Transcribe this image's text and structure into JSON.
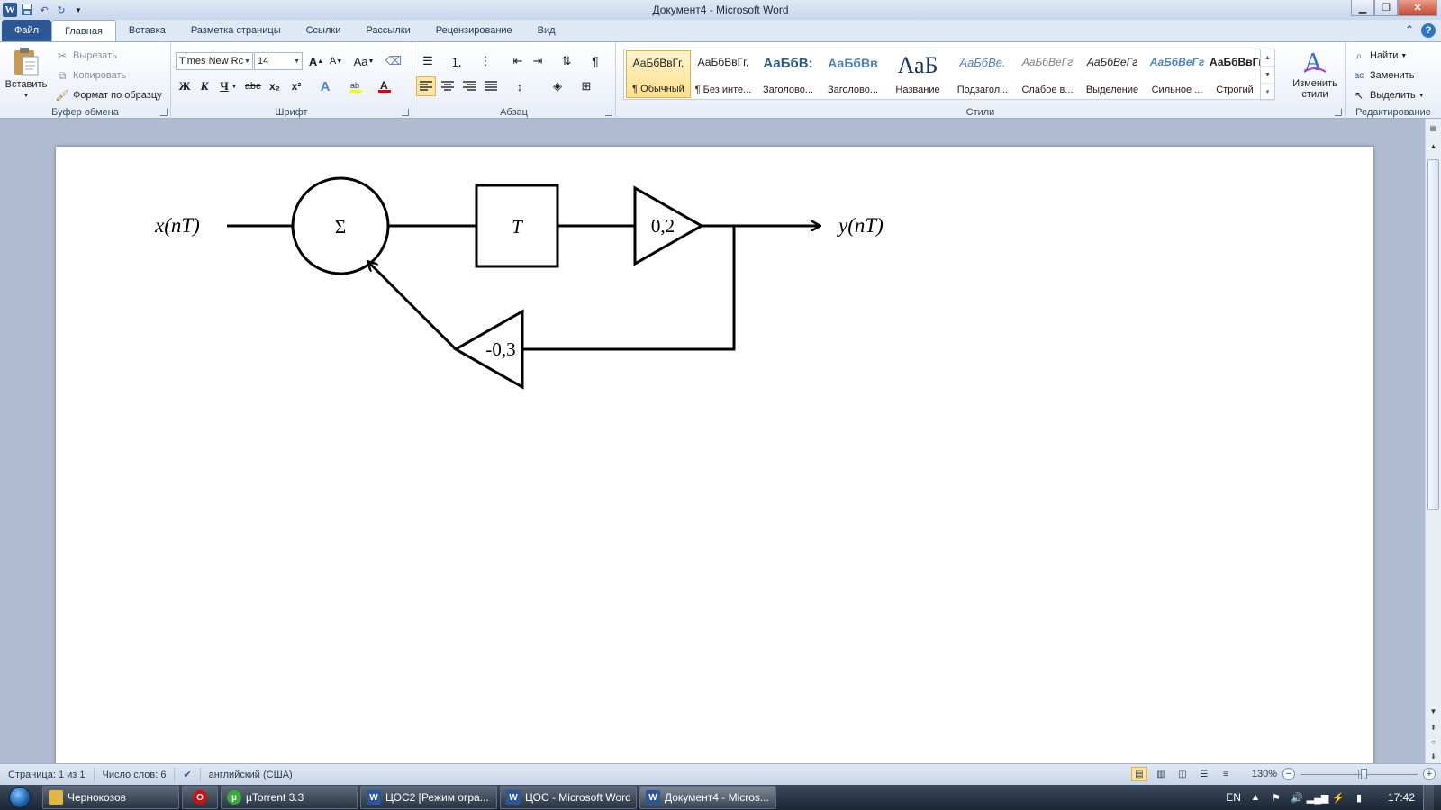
{
  "window": {
    "title": "Документ4  -  Microsoft Word",
    "qat_icons": [
      "word-logo-icon",
      "save-icon",
      "undo-icon",
      "redo-icon",
      "customize-qat-icon"
    ]
  },
  "tabs": [
    {
      "label": "Файл",
      "kind": "file"
    },
    {
      "label": "Главная",
      "kind": "active"
    },
    {
      "label": "Вставка"
    },
    {
      "label": "Разметка страницы"
    },
    {
      "label": "Ссылки"
    },
    {
      "label": "Рассылки"
    },
    {
      "label": "Рецензирование"
    },
    {
      "label": "Вид"
    }
  ],
  "ribbon": {
    "clipboard": {
      "paste": "Вставить",
      "cut": "Вырезать",
      "copy": "Копировать",
      "format_painter": "Формат по образцу",
      "label": "Буфер обмена"
    },
    "font": {
      "family": "Times New Rc",
      "size": "14",
      "label": "Шрифт",
      "bold": "Ж",
      "italic": "К",
      "underline": "Ч",
      "strike": "abe",
      "sub": "x₂",
      "sup": "x²",
      "change_case": "Aa",
      "grow": "A",
      "shrink": "A"
    },
    "paragraph": {
      "label": "Абзац",
      "pilcrow": "¶"
    },
    "styles": {
      "label": "Стили",
      "items": [
        {
          "sample": "АаБбВвГг,",
          "name": "¶ Обычный",
          "color": "#000000",
          "selected": true
        },
        {
          "sample": "АаБбВвГг,",
          "name": "¶ Без инте...",
          "color": "#000000"
        },
        {
          "sample": "АаБбВ:",
          "name": "Заголово...",
          "color": "#2e5c8a"
        },
        {
          "sample": "АаБбВв",
          "name": "Заголово...",
          "color": "#4f81bd"
        },
        {
          "sample": "АаБ",
          "name": "Название",
          "color": "#17365d"
        },
        {
          "sample": "АаБбВе.",
          "name": "Подзагол...",
          "color": "#4f81bd"
        },
        {
          "sample": "АаБбВеГг",
          "name": "Слабое в...",
          "color": "#808080"
        },
        {
          "sample": "АаБбВеГг",
          "name": "Выделение",
          "color": "#000000"
        },
        {
          "sample": "АаБбВеГг",
          "name": "Сильное ...",
          "color": "#4f81bd"
        },
        {
          "sample": "АаБбВвГг,",
          "name": "Строгий",
          "color": "#000000"
        }
      ],
      "change_styles": "Изменить стили"
    },
    "editing": {
      "label": "Редактирование",
      "find": "Найти",
      "replace": "Заменить",
      "select": "Выделить"
    }
  },
  "diagram": {
    "input": "x(nT)",
    "sum": "Σ",
    "delay": "T",
    "gain_forward": "0,2",
    "gain_feedback": "-0,3",
    "output": "y(nT)"
  },
  "status": {
    "page": "Страница: 1 из 1",
    "words": "Число слов: 6",
    "language": "английский (США)",
    "zoom": "130%",
    "zoom_value_percent": 130
  },
  "taskbar": {
    "items": [
      {
        "label": "Чернокозов",
        "icon": "folder-icon",
        "color": "#e0b84a"
      },
      {
        "label": "",
        "icon": "opera-icon",
        "color": "#cc1010"
      },
      {
        "label": "µTorrent 3.3",
        "icon": "utorrent-icon",
        "color": "#3aa93a"
      },
      {
        "label": "ЦОС2 [Режим огра...",
        "icon": "word-icon",
        "color": "#2b579a"
      },
      {
        "label": "ЦОС - Microsoft Word",
        "icon": "word-icon",
        "color": "#2b579a"
      },
      {
        "label": "Документ4 - Micros...",
        "icon": "word-icon",
        "color": "#2b579a",
        "active": true
      }
    ],
    "lang": "EN",
    "time": "17:42"
  }
}
